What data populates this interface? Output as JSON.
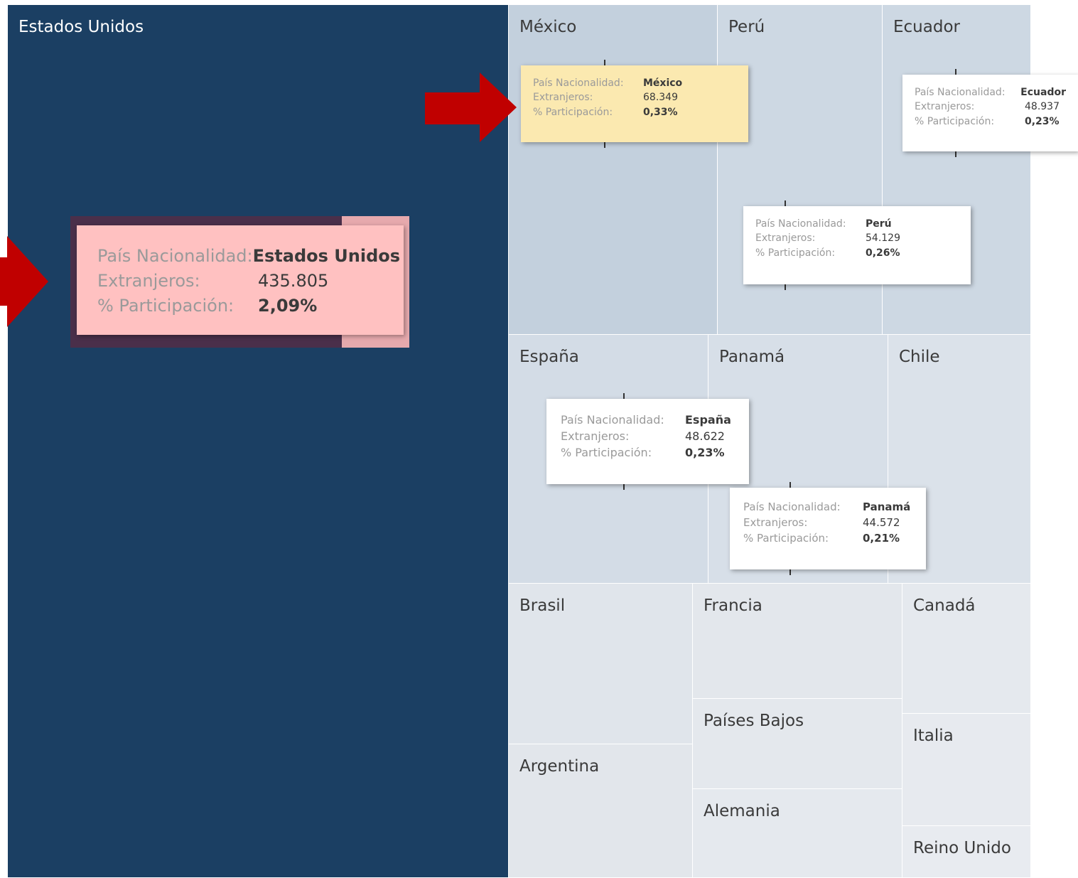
{
  "chart_data": {
    "type": "treemap",
    "items": [
      {
        "name": "Estados Unidos",
        "extranjeros": "435.805",
        "participacion": "2,09%"
      },
      {
        "name": "México",
        "extranjeros": "68.349",
        "participacion": "0,33%"
      },
      {
        "name": "Perú",
        "extranjeros": "54.129",
        "participacion": "0,26%"
      },
      {
        "name": "Ecuador",
        "extranjeros": "48.937",
        "participacion": "0,23%"
      },
      {
        "name": "España",
        "extranjeros": "48.622",
        "participacion": "0,23%"
      },
      {
        "name": "Panamá",
        "extranjeros": "44.572",
        "participacion": "0,21%"
      },
      {
        "name": "Chile"
      },
      {
        "name": "Brasil"
      },
      {
        "name": "Argentina"
      },
      {
        "name": "Francia"
      },
      {
        "name": "Países Bajos"
      },
      {
        "name": "Alemania"
      },
      {
        "name": "Canadá"
      },
      {
        "name": "Italia"
      },
      {
        "name": "Reino Unido"
      }
    ],
    "tooltip_labels": {
      "country": "País Nacionalidad:",
      "foreigners": "Extranjeros:",
      "share": "% Participación:"
    }
  },
  "colors": {
    "dark": "#1b3f63",
    "highlight_red": "#ffc1c1",
    "highlight_yellow": "#fbe9b0",
    "arrow": "#c00000"
  }
}
